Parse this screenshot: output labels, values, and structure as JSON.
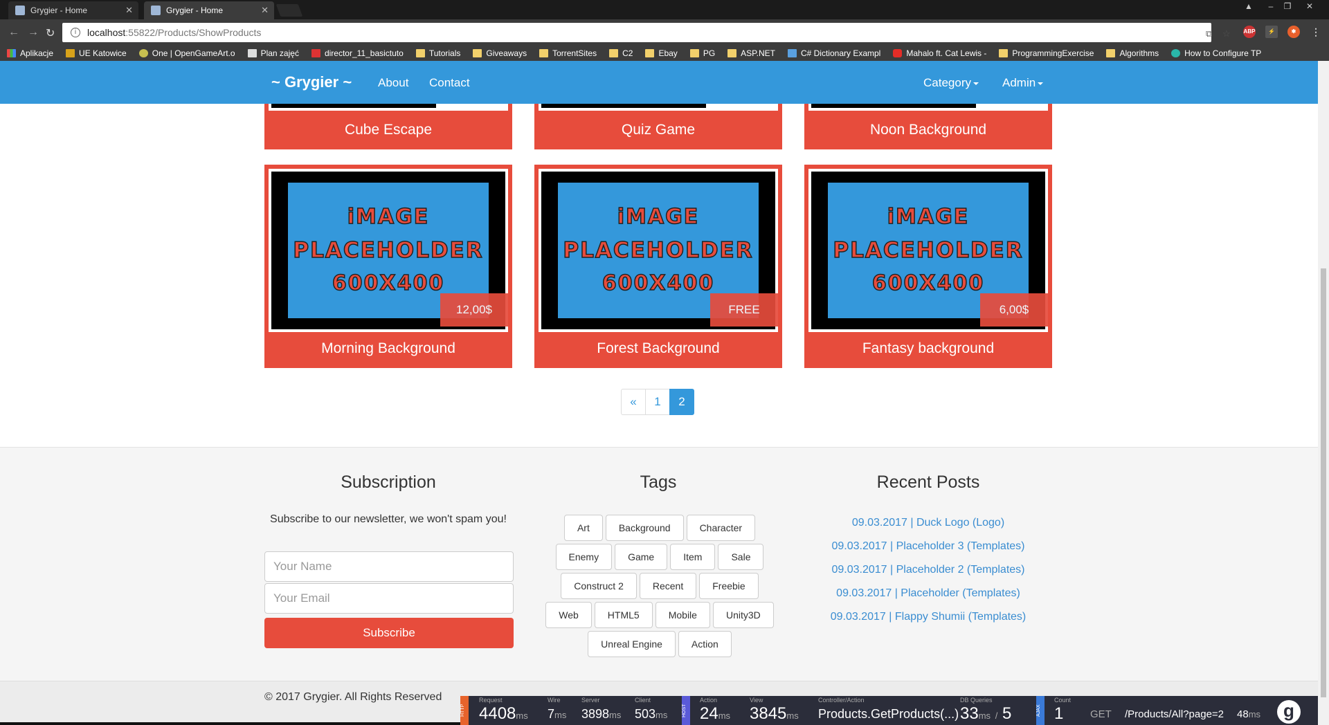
{
  "browser": {
    "tabs": [
      {
        "title": "Grygier - Home"
      },
      {
        "title": "Grygier - Home"
      }
    ],
    "url_host": "localhost",
    "url_path": ":55822/Products/ShowProducts",
    "bookmarks": [
      {
        "label": "Aplikacje",
        "icon": "apps-grid-icon"
      },
      {
        "label": "UE Katowice",
        "icon": "bookmark-icon"
      },
      {
        "label": "One | OpenGameArt.o",
        "icon": "bookmark-icon"
      },
      {
        "label": "Plan zajęć",
        "icon": "page-icon"
      },
      {
        "label": "director_11_basictuto",
        "icon": "pdf-icon"
      },
      {
        "label": "Tutorials",
        "icon": "folder-icon"
      },
      {
        "label": "Giveaways",
        "icon": "folder-icon"
      },
      {
        "label": "TorrentSites",
        "icon": "folder-icon"
      },
      {
        "label": "C2",
        "icon": "folder-icon"
      },
      {
        "label": "Ebay",
        "icon": "folder-icon"
      },
      {
        "label": "PG",
        "icon": "folder-icon"
      },
      {
        "label": "ASP.NET",
        "icon": "folder-icon"
      },
      {
        "label": "C# Dictionary Exampl",
        "icon": "page-icon"
      },
      {
        "label": "Mahalo ft. Cat Lewis -",
        "icon": "youtube-icon"
      },
      {
        "label": "ProgrammingExercise",
        "icon": "folder-icon"
      },
      {
        "label": "Algorithms",
        "icon": "folder-icon"
      },
      {
        "label": "How to Configure TP",
        "icon": "link-icon"
      }
    ]
  },
  "site": {
    "brand": "~ Grygier ~",
    "nav": {
      "about": "About",
      "contact": "Contact",
      "category": "Category",
      "admin": "Admin"
    }
  },
  "products": {
    "top_row": [
      {
        "title": "Cube Escape"
      },
      {
        "title": "Quiz Game"
      },
      {
        "title": "Noon Background"
      }
    ],
    "cards": [
      {
        "title": "Morning Background",
        "price": "12,00$"
      },
      {
        "title": "Forest Background",
        "price": "FREE"
      },
      {
        "title": "Fantasy background",
        "price": "6,00$"
      }
    ],
    "placeholder": {
      "line1": "iMAGE",
      "line2": "PLACEHOLDER",
      "line3": "600X400"
    }
  },
  "pagination": {
    "prev": "«",
    "pages": [
      "1",
      "2"
    ],
    "active": "2"
  },
  "footer": {
    "subscription": {
      "heading": "Subscription",
      "text": "Subscribe to our newsletter, we won't spam you!",
      "name_placeholder": "Your Name",
      "email_placeholder": "Your Email",
      "button": "Subscribe"
    },
    "tags": {
      "heading": "Tags",
      "items": [
        "Art",
        "Background",
        "Character",
        "Enemy",
        "Game",
        "Item",
        "Sale",
        "Construct 2",
        "Recent",
        "Freebie",
        "Web",
        "HTML5",
        "Mobile",
        "Unity3D",
        "Unreal Engine",
        "Action"
      ]
    },
    "recent_posts": {
      "heading": "Recent Posts",
      "items": [
        "09.03.2017 | Duck Logo (Logo)",
        "09.03.2017 | Placeholder 3 (Templates)",
        "09.03.2017 | Placeholder 2 (Templates)",
        "09.03.2017 | Placeholder (Templates)",
        "09.03.2017 | Flappy Shumii (Templates)"
      ]
    },
    "copyright": "© 2017 Grygier. All Rights Reserved"
  },
  "glimpse": {
    "request": {
      "label": "Request",
      "value": "4408",
      "unit": "ms"
    },
    "wire": {
      "label": "Wire",
      "value": "7",
      "unit": "ms"
    },
    "server": {
      "label": "Server",
      "value": "3898",
      "unit": "ms"
    },
    "client": {
      "label": "Client",
      "value": "503",
      "unit": "ms"
    },
    "action": {
      "label": "Action",
      "value": "24",
      "unit": "ms"
    },
    "view": {
      "label": "View",
      "value": "3845",
      "unit": "ms"
    },
    "controller": {
      "label": "Controller/Action",
      "value": "Products.GetProducts(...)"
    },
    "db": {
      "label": "DB Queries",
      "value": "33",
      "unit": "ms",
      "sep": "/",
      "count": "5"
    },
    "ajax": {
      "label": "Count",
      "value": "1"
    },
    "method": "GET",
    "path": "/Products/All?page=2",
    "time": "48",
    "time_unit": "ms",
    "tag_http": "HTTP",
    "tag_host": "HOST",
    "tag_ajax": "AJAX"
  },
  "colors": {
    "primary": "#3498db",
    "accent": "#e74c3c",
    "link": "#3a8dd1"
  }
}
